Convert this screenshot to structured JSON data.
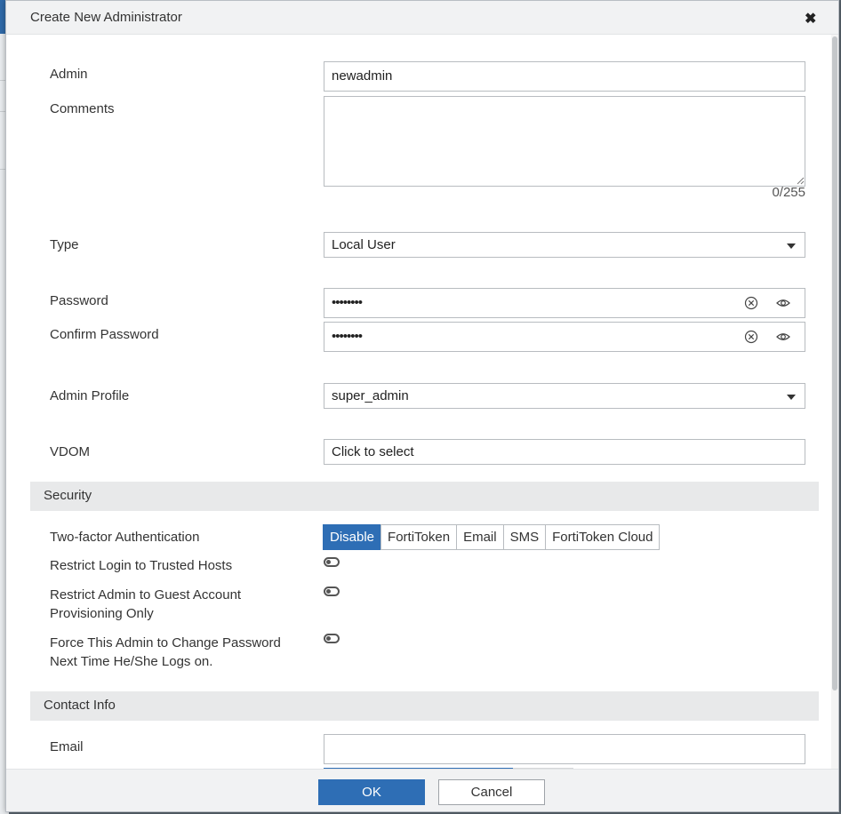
{
  "dialog": {
    "title": "Create New Administrator",
    "close_icon": "close-icon"
  },
  "form": {
    "admin_label": "Admin",
    "admin_value": "newadmin",
    "comments_label": "Comments",
    "comments_value": "",
    "comments_counter": "0/255",
    "type_label": "Type",
    "type_value": "Local User",
    "password_label": "Password",
    "password_value": "••••••••",
    "confirm_password_label": "Confirm Password",
    "confirm_password_value": "••••••••",
    "admin_profile_label": "Admin Profile",
    "admin_profile_value": "super_admin",
    "vdom_label": "VDOM",
    "vdom_placeholder": "Click to select"
  },
  "security": {
    "heading": "Security",
    "two_factor_label": "Two-factor Authentication",
    "two_factor_options": [
      "Disable",
      "FortiToken",
      "Email",
      "SMS",
      "FortiToken Cloud"
    ],
    "two_factor_selected": "Disable",
    "restrict_trusted_label": "Restrict Login to Trusted Hosts",
    "restrict_trusted_on": false,
    "restrict_guest_label_1": "Restrict Admin to Guest Account",
    "restrict_guest_label_2": "Provisioning Only",
    "restrict_guest_on": false,
    "force_change_label_1": "Force This Admin to Change Password",
    "force_change_label_2": "Next Time He/She Logs on.",
    "force_change_on": false
  },
  "contact": {
    "heading": "Contact Info",
    "email_label": "Email",
    "email_value": ""
  },
  "footer": {
    "ok_label": "OK",
    "cancel_label": "Cancel"
  },
  "colors": {
    "accent": "#2e6eb5",
    "header_bg": "#f1f2f3",
    "section_bg": "#e8e9ea"
  }
}
